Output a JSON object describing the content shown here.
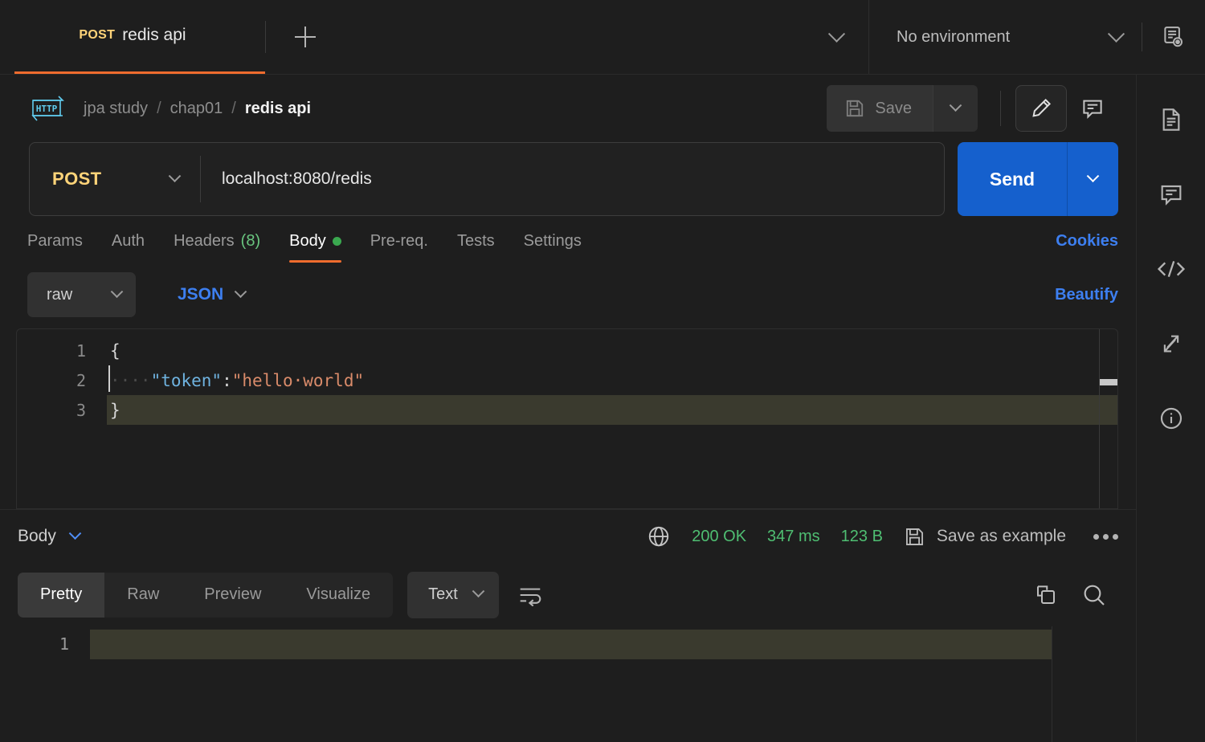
{
  "tabbar": {
    "request_tab": {
      "method": "POST",
      "name": "redis api"
    },
    "new_tab_icon": "plus-icon",
    "tab_list_chevron": "chevron-down-icon",
    "environment": {
      "selected": "No environment"
    },
    "env_quick_look_icon": "env-quick-look-icon"
  },
  "breadcrumb": {
    "protocol_badge": "HTTP",
    "items": [
      "jpa study",
      "chap01",
      "redis api"
    ],
    "separator": "/"
  },
  "actions": {
    "save_label": "Save",
    "save_caret_icon": "chevron-down-icon",
    "edit_icon": "pencil-icon",
    "comment_icon": "comment-icon"
  },
  "url_bar": {
    "method": "POST",
    "method_caret_icon": "chevron-down-icon",
    "url": "localhost:8080/redis",
    "send_label": "Send",
    "send_caret_icon": "chevron-down-icon"
  },
  "request_tabs": {
    "items": [
      {
        "label": "Params",
        "active": false
      },
      {
        "label": "Auth",
        "active": false
      },
      {
        "label": "Headers",
        "count": "(8)",
        "active": false
      },
      {
        "label": "Body",
        "active": true,
        "dot": true
      },
      {
        "label": "Pre-req.",
        "active": false
      },
      {
        "label": "Tests",
        "active": false
      },
      {
        "label": "Settings",
        "active": false
      }
    ],
    "cookies_label": "Cookies"
  },
  "body_controls": {
    "mode": "raw",
    "mode_caret_icon": "chevron-down-icon",
    "language": "JSON",
    "language_caret_icon": "chevron-down-icon",
    "beautify_label": "Beautify"
  },
  "request_body": {
    "lines": [
      {
        "num": "1",
        "tokens": [
          {
            "t": "{",
            "c": "punc"
          }
        ],
        "highlight": false
      },
      {
        "num": "2",
        "tokens": [
          {
            "t": "····",
            "c": "ws"
          },
          {
            "t": "\"token\"",
            "c": "key"
          },
          {
            "t": ":",
            "c": "punc"
          },
          {
            "t": "\"hello·world\"",
            "c": "str"
          }
        ],
        "highlight": false
      },
      {
        "num": "3",
        "tokens": [
          {
            "t": "}",
            "c": "punc"
          }
        ],
        "highlight": true
      }
    ]
  },
  "response_meta": {
    "body_label": "Body",
    "body_caret_icon": "chevron-down-icon",
    "globe_icon": "globe-icon",
    "status": "200 OK",
    "time": "347 ms",
    "size": "123 B",
    "save_example_label": "Save as example",
    "save_example_icon": "floppy-icon",
    "more_icon": "ellipsis-icon",
    "status_color": "#4fbe72"
  },
  "response_tabs": {
    "items": [
      {
        "label": "Pretty",
        "active": true
      },
      {
        "label": "Raw",
        "active": false
      },
      {
        "label": "Preview",
        "active": false
      },
      {
        "label": "Visualize",
        "active": false
      }
    ],
    "format": "Text",
    "format_caret_icon": "chevron-down-icon",
    "wrap_icon": "text-wrap-icon",
    "copy_icon": "copy-icon",
    "search_icon": "search-icon"
  },
  "response_body": {
    "lines": [
      {
        "num": "1",
        "text": ""
      }
    ]
  },
  "right_rail": {
    "items": [
      {
        "icon": "documentation-icon"
      },
      {
        "icon": "comment-icon"
      },
      {
        "icon": "code-snippet-icon"
      },
      {
        "icon": "sync-icon"
      },
      {
        "icon": "info-icon"
      }
    ]
  },
  "colors": {
    "accent_orange": "#ef6c2e",
    "method_yellow": "#ffd479",
    "link_blue": "#3d7ff0",
    "send_blue": "#1560cd",
    "status_green": "#4fbe72",
    "http_badge_cyan": "#61cdf0"
  }
}
